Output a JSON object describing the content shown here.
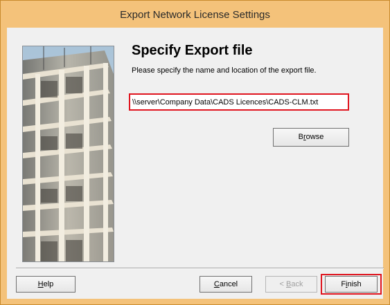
{
  "window": {
    "title": "Export Network License Settings"
  },
  "page": {
    "heading": "Specify Export file",
    "instruction": "Please specify the name and location of the export file."
  },
  "export_path": {
    "value": "\\\\server\\Company Data\\CADS Licences\\CADS-CLM.txt"
  },
  "buttons": {
    "browse": {
      "pre": "B",
      "mnemonic": "r",
      "post": "owse"
    },
    "help": {
      "pre": "",
      "mnemonic": "H",
      "post": "elp"
    },
    "cancel": {
      "pre": "",
      "mnemonic": "C",
      "post": "ancel"
    },
    "back": {
      "pre": "< ",
      "mnemonic": "B",
      "post": "ack"
    },
    "finish": {
      "pre": "F",
      "mnemonic": "i",
      "post": "nish"
    }
  },
  "colors": {
    "title_bar": "#f4c27a",
    "highlight_border": "#e0141e",
    "dialog_background": "#f0f0f0"
  }
}
